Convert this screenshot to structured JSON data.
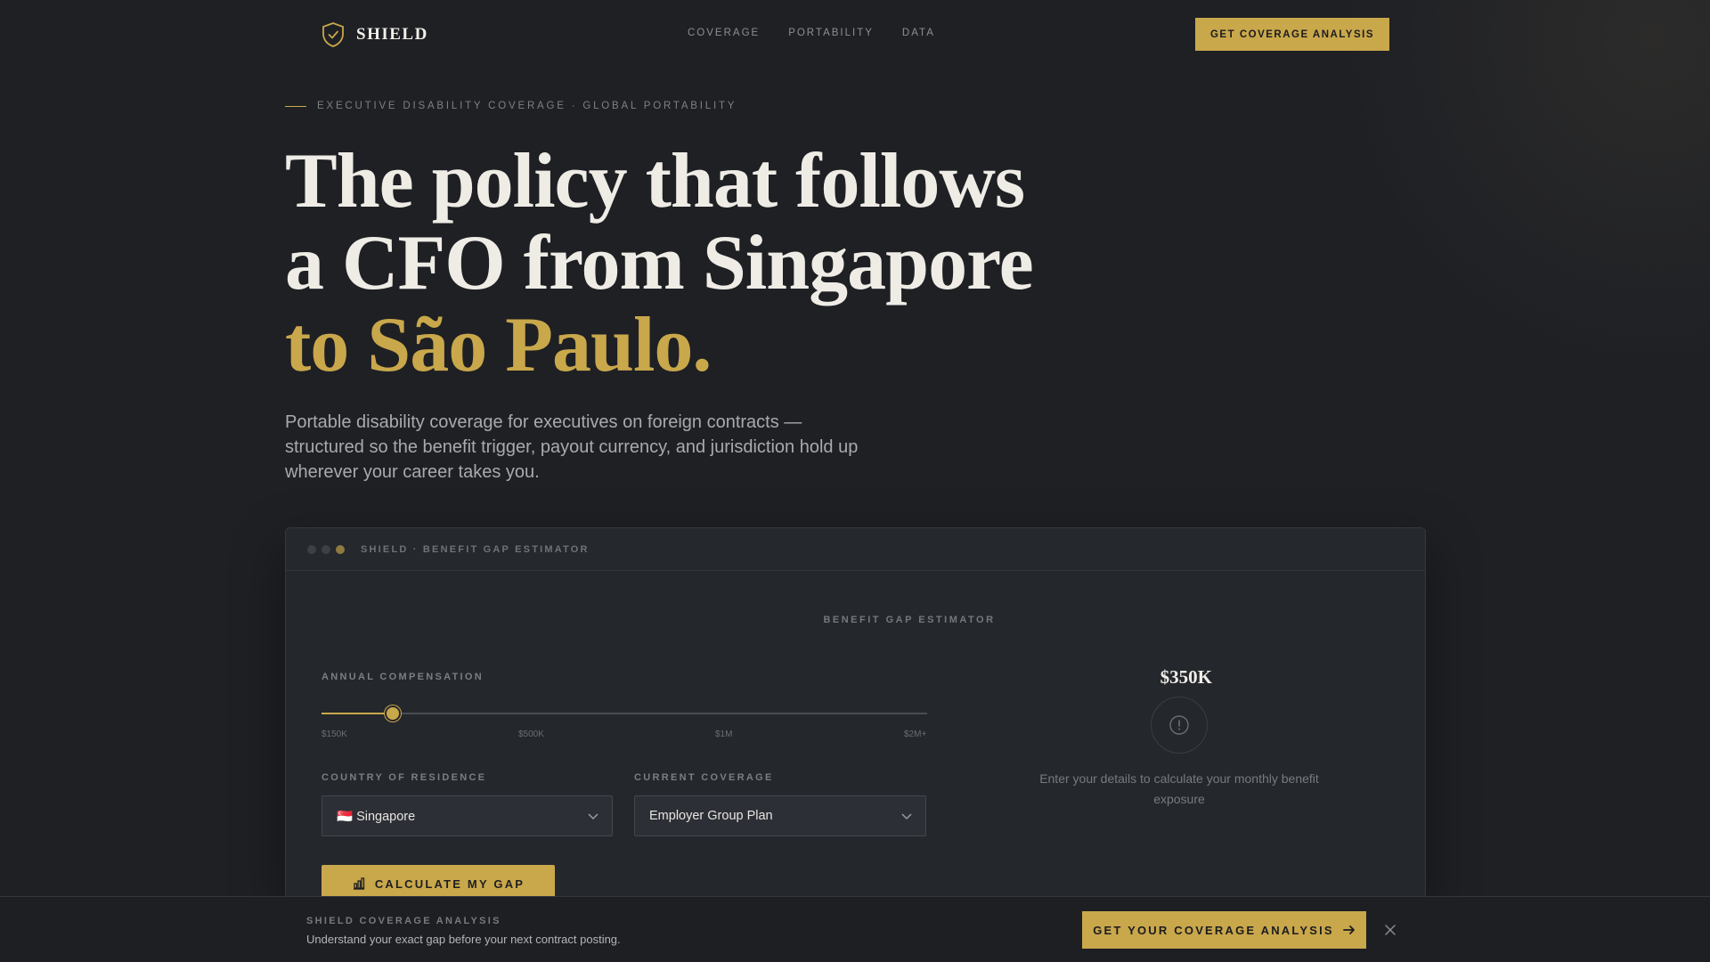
{
  "brand": {
    "name": "SHIELD",
    "logo_icon": "shield-check-icon",
    "accent": "#c9a74b"
  },
  "nav": {
    "links": [
      "COVERAGE",
      "PORTABILITY",
      "DATA"
    ],
    "cta_label": "GET COVERAGE ANALYSIS"
  },
  "hero": {
    "eyebrow": "EXECUTIVE DISABILITY COVERAGE · GLOBAL PORTABILITY",
    "headline_line1": "The policy that follows",
    "headline_line2": "a CFO from Singapore",
    "headline_accent": "to São Paulo.",
    "subcopy": "Portable disability coverage for executives on foreign contracts — structured so the benefit trigger, payout currency, and jurisdiction hold up wherever your career takes you."
  },
  "estimator": {
    "window_title": "SHIELD · BENEFIT GAP ESTIMATOR",
    "section_label": "BENEFIT GAP ESTIMATOR",
    "compensation": {
      "label": "ANNUAL COMPENSATION",
      "value_display": "$350K",
      "fraction": 0.117,
      "ticks": [
        "$150K",
        "$500K",
        "$1M",
        "$2M+"
      ]
    },
    "country": {
      "label": "COUNTRY OF RESIDENCE",
      "value": "🇸🇬 Singapore"
    },
    "coverage": {
      "label": "CURRENT COVERAGE",
      "value": "Employer Group Plan"
    },
    "calculate_label": "CALCULATE MY GAP",
    "empty_state_text": "Enter your details to calculate your monthly benefit exposure"
  },
  "bottom_bar": {
    "title": "SHIELD COVERAGE ANALYSIS",
    "text": "Understand your exact gap before your next contract posting.",
    "cta_label": "GET YOUR COVERAGE ANALYSIS"
  }
}
